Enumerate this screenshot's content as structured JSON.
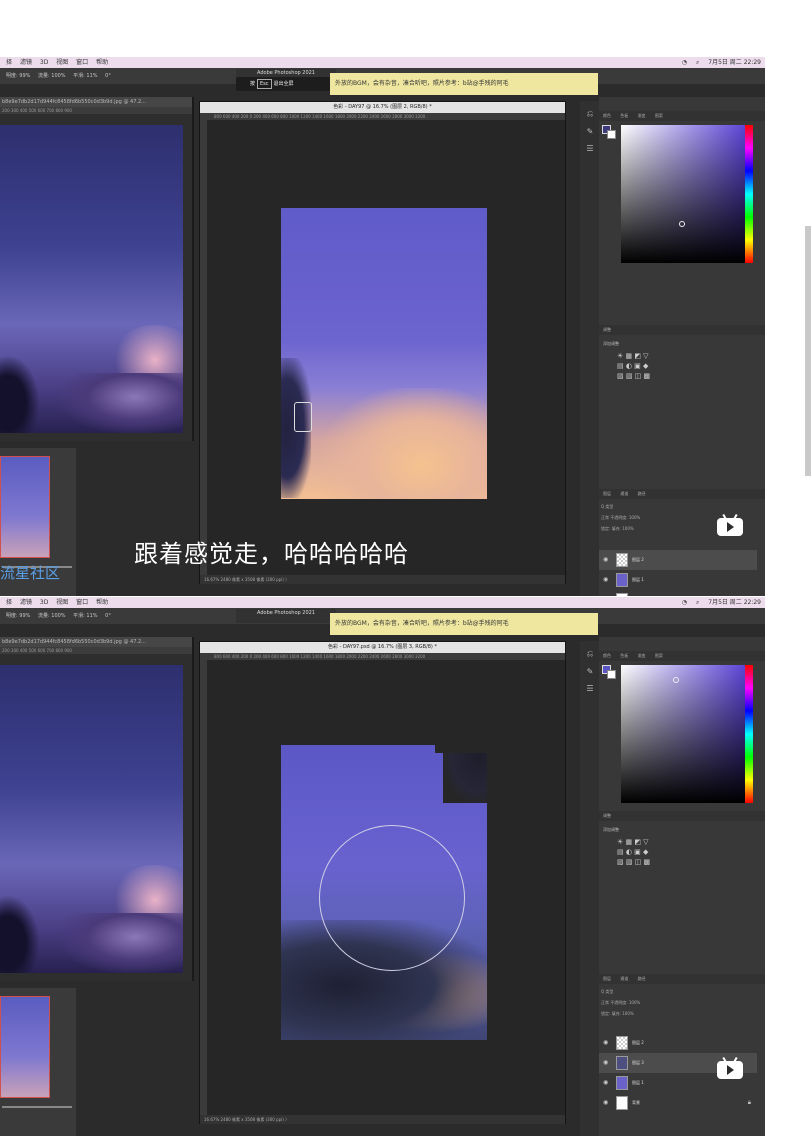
{
  "top": {
    "menubar": {
      "items": [
        "择",
        "滤镜",
        "3D",
        "视图",
        "窗口",
        "帮助"
      ],
      "date": "7月5日 周二 22:29"
    },
    "options": [
      "明度: 99%",
      "流量: 100%",
      "平滑: 11%",
      "0°"
    ],
    "app_title": "Adobe Photoshop 2021",
    "esc_hint": {
      "prefix": "按",
      "key": "Esc",
      "suffix": "退出全屏"
    },
    "banner": "外放的BGM，会有杂音，凑合听吧，照片参考：b站@手残的阿毛",
    "ref_tab": "b8e9e7db2d17d944fc8458fd6b550c0d3b9d.jpg @ 47.2...",
    "ref_ruler": "200  300  400  500  600  700  800  900",
    "doc_title": "色彩 - DAY97 @ 16.7% (图层 2, RGB/8) *",
    "doc_ruler": "800 600 400 200 0   200 400 600 800 1000 1200 1400 1600 1800 2000 2200 2400 2600 2800 3000 3200",
    "doc_status": "16.67%   2480 像素 x 3508 像素 (300 ppi)   〉",
    "subtitle": "跟着感觉走，哈哈哈哈哈",
    "watermark": "流星社区",
    "color_tabs": [
      "颜色",
      "色板",
      "渐变",
      "图案"
    ],
    "adj_title": "调整",
    "adj_sub": "添加调整",
    "layers_tabs": [
      "图层",
      "通道",
      "路径"
    ],
    "layers_opts": [
      "Q 类型",
      "正常   不透明度: 100%",
      "锁定:   填充: 100%"
    ],
    "layers": [
      {
        "name": "图层 2",
        "selected": true
      },
      {
        "name": "图层 1",
        "selected": false
      },
      {
        "name": "背景",
        "selected": false
      }
    ]
  },
  "bottom": {
    "menubar": {
      "items": [
        "择",
        "滤镜",
        "3D",
        "视图",
        "窗口",
        "帮助"
      ],
      "date": "7月5日 周二 22:29"
    },
    "options": [
      "明度: 99%",
      "流量: 100%",
      "平滑: 11%",
      "0°"
    ],
    "app_title": "Adobe Photoshop 2021",
    "banner": "外放的BGM，会有杂音，凑合听吧，照片参考：b站@手残的阿毛",
    "ref_tab": "b8e9e7db2d17d944fc8458fd6b550c0d3b9d.jpg @ 47.2...",
    "ref_ruler": "200  300  400  500  600  700  800  900",
    "doc_title": "色彩 - DAY97.psd @ 16.7% (图层 3, RGB/8) *",
    "doc_ruler": "800 600 400 200 0   200 400 600 800 1000 1200 1400 1600 1800 2000 2200 2400 2600 2800 3000 3200",
    "doc_status": "16.67%   2480 像素 x 3508 像素 (300 ppi)   〉",
    "color_tabs": [
      "颜色",
      "色板",
      "渐变",
      "图案"
    ],
    "adj_title": "调整",
    "adj_sub": "添加调整",
    "layers_tabs": [
      "图层",
      "通道",
      "路径"
    ],
    "layers_opts": [
      "Q 类型",
      "正常   不透明度: 100%",
      "锁定:   填充: 100%"
    ],
    "layers": [
      {
        "name": "图层 2",
        "selected": false
      },
      {
        "name": "图层 3",
        "selected": true
      },
      {
        "name": "图层 1",
        "selected": false
      },
      {
        "name": "背景",
        "selected": false
      }
    ]
  },
  "colors": {
    "accent_violet": "#6c64cf",
    "banner": "#efe7a0",
    "watermark": "#5aa0e8"
  }
}
